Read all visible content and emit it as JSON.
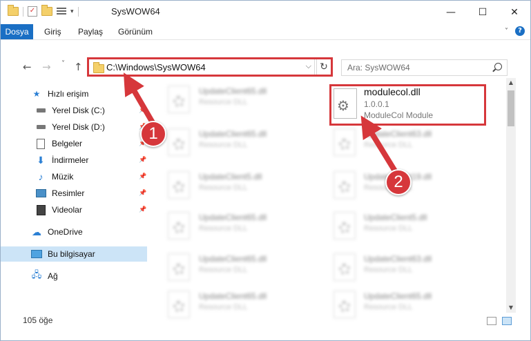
{
  "window": {
    "title": "SysWOW64",
    "controls": {
      "minimize": "—",
      "maximize": "☐",
      "close": "✕"
    }
  },
  "ribbon": {
    "tabs": [
      "Dosya",
      "Giriş",
      "Paylaş",
      "Görünüm"
    ],
    "help": "?"
  },
  "nav": {
    "back": "←",
    "forward": "→",
    "recent": "˅",
    "up": "↑",
    "address": "C:\\Windows\\SysWOW64",
    "refresh": "↻",
    "search_placeholder": "Ara: SysWOW64"
  },
  "sidebar": {
    "items": [
      {
        "label": "Hızlı erişim",
        "icon": "star-icon",
        "pinned": false
      },
      {
        "label": "Yerel Disk (C:)",
        "icon": "drive-icon",
        "pinned": true
      },
      {
        "label": "Yerel Disk (D:)",
        "icon": "drive-icon",
        "pinned": true
      },
      {
        "label": "Belgeler",
        "icon": "document-icon",
        "pinned": true
      },
      {
        "label": "İndirmeler",
        "icon": "download-icon",
        "pinned": true
      },
      {
        "label": "Müzik",
        "icon": "music-icon",
        "pinned": true
      },
      {
        "label": "Resimler",
        "icon": "pictures-icon",
        "pinned": true
      },
      {
        "label": "Videolar",
        "icon": "video-icon",
        "pinned": true
      },
      {
        "label": "OneDrive",
        "icon": "cloud-icon",
        "pinned": false
      },
      {
        "label": "Bu bilgisayar",
        "icon": "computer-icon",
        "pinned": false,
        "selected": true
      },
      {
        "label": "Ağ",
        "icon": "network-icon",
        "pinned": false
      }
    ]
  },
  "files_left": [
    {
      "name": "UpdateClient65.dll",
      "type": "Resource DLL"
    },
    {
      "name": "UpdateClient65.dll",
      "type": "Resource DLL"
    },
    {
      "name": "UpdateClient5.dll",
      "type": "Resource DLL"
    },
    {
      "name": "UpdateClient65.dll",
      "type": "Resource DLL"
    },
    {
      "name": "UpdateClient65.dll",
      "type": "Resource DLL"
    },
    {
      "name": "UpdateClient65.dll",
      "type": "Resource DLL"
    }
  ],
  "files_right": [
    {
      "name": "UpdateClient63.dll",
      "type": "Resource DLL"
    },
    {
      "name": "UpdateClient19.dll",
      "type": "Resource DLL"
    },
    {
      "name": "UpdateClient5.dll",
      "type": "Resource DLL"
    },
    {
      "name": "UpdateClient63.dll",
      "type": "Resource DLL"
    },
    {
      "name": "UpdateClient65.dll",
      "type": "Resource DLL"
    }
  ],
  "target_file": {
    "name": "modulecol.dll",
    "version": "1.0.0.1",
    "description": "ModuleCol Module"
  },
  "status": {
    "count": "105 öğe"
  },
  "annotations": {
    "badge1": "1",
    "badge2": "2",
    "color": "#d6373b"
  }
}
